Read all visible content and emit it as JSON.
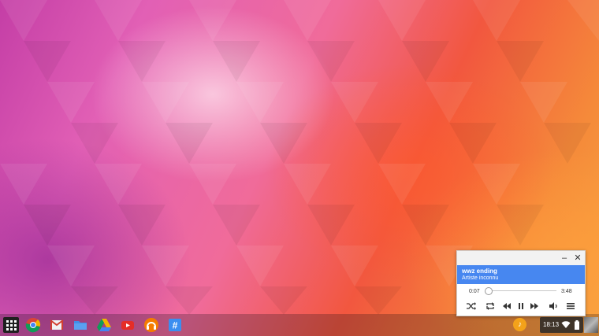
{
  "media_popup": {
    "minimize_glyph": "–",
    "close_glyph": "✕",
    "track_title": "wwz ending",
    "artist": "Artiste inconnu",
    "elapsed": "0:07",
    "duration": "3:48",
    "progress_fraction": 0.03,
    "accent_color": "#4787f0"
  },
  "shelf": {
    "apps": [
      "launcher-icon",
      "chrome-icon",
      "gmail-icon",
      "files-icon",
      "drive-icon",
      "youtube-icon",
      "play-music-icon",
      "hashtag-app-icon"
    ]
  },
  "tray": {
    "notification_glyph": "♪",
    "clock": "18:13"
  }
}
